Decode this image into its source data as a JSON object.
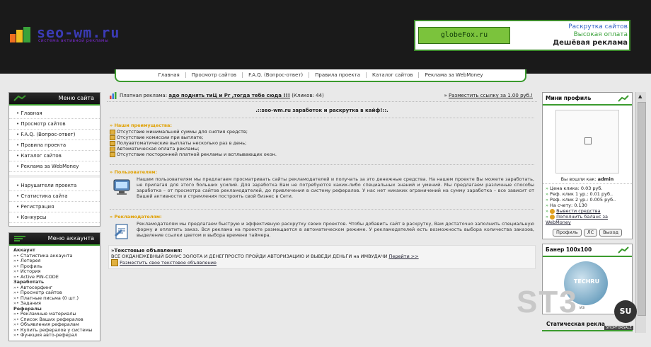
{
  "header": {
    "logo_text": "seo-wm.ru",
    "logo_sub": "система активной рекламы",
    "banner": {
      "left_text": "globeFox.ru",
      "line1": "Раскрутка сайтов",
      "line2": "Высокая оплата",
      "line3": "Дешёвая реклама"
    }
  },
  "nav": [
    "Главная",
    "Просмотр сайтов",
    "F.A.Q. (Вопрос-ответ)",
    "Правила проекта",
    "Каталог сайтов",
    "Реклама за WebMoney"
  ],
  "left": {
    "site_menu_title": "Меню сайта",
    "site_menu": [
      "Главная",
      "Просмотр сайтов",
      "F.A.Q. (Вопрос-ответ)",
      "Правила проекта",
      "Каталог сайтов",
      "Реклама за WebMoney"
    ],
    "site_menu2": [
      "Нарушители проекта",
      "Статистика сайта",
      "Регистрация",
      "Конкурсы"
    ],
    "account_title": "Меню аккаунта",
    "account": [
      {
        "type": "sec",
        "label": "Аккаунт"
      },
      {
        "type": "it",
        "label": "Статистика аккаунта"
      },
      {
        "type": "it",
        "label": "Лотерея"
      },
      {
        "type": "it",
        "label": "Профиль"
      },
      {
        "type": "it",
        "label": "История"
      },
      {
        "type": "it",
        "label": "Active PIN-CODE"
      },
      {
        "type": "sec",
        "label": "Заработать"
      },
      {
        "type": "it",
        "label": "Автосерфинг"
      },
      {
        "type": "it",
        "label": "Просмотр сайтов"
      },
      {
        "type": "it",
        "label": "Платные письма (0 шт.)"
      },
      {
        "type": "it",
        "label": "Задания"
      },
      {
        "type": "sec",
        "label": "Рефералы"
      },
      {
        "type": "it",
        "label": "Рекламные материалы"
      },
      {
        "type": "it",
        "label": "Список Ваших рефералов"
      },
      {
        "type": "it",
        "label": "Объявления рефералам"
      },
      {
        "type": "it",
        "label": "Купить рефералов у системы"
      },
      {
        "type": "it",
        "label": "Функция авто-реферал"
      }
    ]
  },
  "main": {
    "paid_label": "Платная реклама:",
    "paid_link": "адо поднять тиЦ и Pr ,тогда тебе сюда !!!",
    "paid_clicks": "(Кликов: 44)",
    "place_link": "Разместить ссылку за 1.00 руб.!",
    "title": ".::seo-wm.ru заработок и раскрутка в кайф!::.",
    "adv_title": "» Наши преимущества:",
    "adv": [
      "Отсутствие минимальной суммы для снятия средств;",
      "Отсутствие комиссии при выплате;",
      "Полуавтоматические выплаты несколько раз в день;",
      "Автоматическая оплата рекламы;",
      "Отсутствие посторонней платной рекламы и всплывающих окон."
    ],
    "users_title": "» Пользователям:",
    "users_text": "Нашим пользователям мы предлагаем просматривать сайты рекламодателей и получать за это денежные средства. На нашем проекте Вы можете заработать, не прилагая для этого больших усилий. Для заработка Вам не потребуются каких-либо специальных знаний и умений. Мы предлагаем различные способы заработка – от просмотра сайтов рекламодателей, до привлечения в систему рефералов. У нас нет никаких ограничений на сумму заработка – все зависит от Вашей активности и стремления построить свой бизнес в Сети.",
    "adv2_title": "» Рекламодателям:",
    "adv2_text": "Рекламодателям мы предлагаем быструю и эффективную раскрутку своих проектов. Чтобы добавить сайт в раскрутку, Вам достаточно заполнить специальную форму и оплатить заказ. Вся реклама на проекте размещается в автоматическом режиме. У рекламодателей есть возможность выбора количества заказов, выделение ссылки цветом и выбора времени таймера.",
    "textads_title": "»Текстовые объявления:",
    "textads_line": "ВСЕ ОКДАНЕЖЕВНЫЙ БОНУС ЗОЛОТА И ДЕНЕГПРОСТО ПРОЙДИ АВТОРИЗАЦИЮ И ВЫВЕДИ ДЕНЬГИ на ИМВУДАЧИ",
    "textads_more": "Перейти >>",
    "textads_place": "Разместить свое текстовое объявление"
  },
  "right": {
    "profile_title": "Мини профиль",
    "whois_label": "Вы вошли как:",
    "user": "admin",
    "stats": [
      "Цена клика: 0.03 руб.",
      "Реф. клик 1 ур.: 0.01 руб..",
      "Реф. клик 2 ур.: 0.005 руб..",
      "На счету: 0.130"
    ],
    "withdraw": "Вывести средства",
    "topup": "Пополнить баланс за WebMoney",
    "buttons": [
      "Профиль",
      "ЛС",
      "Выход"
    ],
    "banner_title": "Банер 100x100",
    "banner_text": "TECHRU",
    "banner_sub": "из",
    "static_title": "Статическая рекла"
  },
  "watermark": {
    "main": "ST3",
    "su": "SU",
    "sub": "SHOPFORSALE"
  }
}
